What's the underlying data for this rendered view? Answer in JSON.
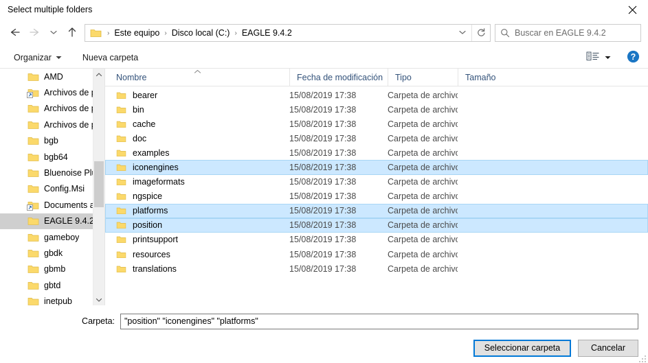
{
  "window": {
    "title": "Select multiple folders",
    "close_icon": "close-icon"
  },
  "nav": {
    "back_icon": "arrow-left-icon",
    "forward_icon": "arrow-right-icon",
    "recent_icon": "chevron-down-icon",
    "up_icon": "arrow-up-icon",
    "dropdown_icon": "chevron-down-icon",
    "refresh_icon": "refresh-icon",
    "folder_icon": "folder-icon",
    "breadcrumbs": [
      "Este equipo",
      "Disco local (C:)",
      "EAGLE 9.4.2"
    ],
    "separator": "›"
  },
  "search": {
    "placeholder": "Buscar en EAGLE 9.4.2",
    "icon": "search-icon",
    "value": ""
  },
  "toolbar": {
    "organize_label": "Organizar",
    "organize_caret_icon": "caret-down-icon",
    "new_folder_label": "Nueva carpeta",
    "view_icon": "view-layout-icon",
    "view_caret_icon": "caret-down-icon",
    "help_icon": "help-circle-icon",
    "help_label": "?"
  },
  "tree": {
    "scroll_up_icon": "chevron-up-icon",
    "scroll_down_icon": "chevron-down-icon",
    "items": [
      {
        "label": "AMD",
        "icon": "folder-icon",
        "shortcut": false,
        "selected": false
      },
      {
        "label": "Archivos de pr",
        "icon": "folder-icon",
        "shortcut": true,
        "selected": false
      },
      {
        "label": "Archivos de pr",
        "icon": "folder-icon",
        "shortcut": false,
        "selected": false
      },
      {
        "label": "Archivos de pr",
        "icon": "folder-icon",
        "shortcut": false,
        "selected": false
      },
      {
        "label": "bgb",
        "icon": "folder-icon",
        "shortcut": false,
        "selected": false
      },
      {
        "label": "bgb64",
        "icon": "folder-icon",
        "shortcut": false,
        "selected": false
      },
      {
        "label": "Bluenoise Plug",
        "icon": "folder-icon",
        "shortcut": false,
        "selected": false
      },
      {
        "label": "Config.Msi",
        "icon": "folder-icon",
        "shortcut": false,
        "selected": false
      },
      {
        "label": "Documents an",
        "icon": "folder-icon",
        "shortcut": true,
        "selected": false
      },
      {
        "label": "EAGLE 9.4.2",
        "icon": "folder-icon",
        "shortcut": false,
        "selected": true
      },
      {
        "label": "gameboy",
        "icon": "folder-icon",
        "shortcut": false,
        "selected": false
      },
      {
        "label": "gbdk",
        "icon": "folder-icon",
        "shortcut": false,
        "selected": false
      },
      {
        "label": "gbmb",
        "icon": "folder-icon",
        "shortcut": false,
        "selected": false
      },
      {
        "label": "gbtd",
        "icon": "folder-icon",
        "shortcut": false,
        "selected": false
      },
      {
        "label": "inetpub",
        "icon": "folder-icon",
        "shortcut": false,
        "selected": false
      }
    ]
  },
  "filelist": {
    "columns": [
      "Nombre",
      "Fecha de modificación",
      "Tipo",
      "Tamaño"
    ],
    "sort_column": "Nombre",
    "sort_direction": "ascending",
    "sort_icon": "chevron-up-icon",
    "rows": [
      {
        "name": "bearer",
        "date": "15/08/2019 17:38",
        "type": "Carpeta de archivos",
        "size": "",
        "selected": false,
        "icon": "folder-icon"
      },
      {
        "name": "bin",
        "date": "15/08/2019 17:38",
        "type": "Carpeta de archivos",
        "size": "",
        "selected": false,
        "icon": "folder-icon"
      },
      {
        "name": "cache",
        "date": "15/08/2019 17:38",
        "type": "Carpeta de archivos",
        "size": "",
        "selected": false,
        "icon": "folder-icon"
      },
      {
        "name": "doc",
        "date": "15/08/2019 17:38",
        "type": "Carpeta de archivos",
        "size": "",
        "selected": false,
        "icon": "folder-icon"
      },
      {
        "name": "examples",
        "date": "15/08/2019 17:38",
        "type": "Carpeta de archivos",
        "size": "",
        "selected": false,
        "icon": "folder-icon"
      },
      {
        "name": "iconengines",
        "date": "15/08/2019 17:38",
        "type": "Carpeta de archivos",
        "size": "",
        "selected": true,
        "icon": "folder-icon"
      },
      {
        "name": "imageformats",
        "date": "15/08/2019 17:38",
        "type": "Carpeta de archivos",
        "size": "",
        "selected": false,
        "icon": "folder-icon"
      },
      {
        "name": "ngspice",
        "date": "15/08/2019 17:38",
        "type": "Carpeta de archivos",
        "size": "",
        "selected": false,
        "icon": "folder-icon"
      },
      {
        "name": "platforms",
        "date": "15/08/2019 17:38",
        "type": "Carpeta de archivos",
        "size": "",
        "selected": true,
        "icon": "folder-icon"
      },
      {
        "name": "position",
        "date": "15/08/2019 17:38",
        "type": "Carpeta de archivos",
        "size": "",
        "selected": true,
        "icon": "folder-icon"
      },
      {
        "name": "printsupport",
        "date": "15/08/2019 17:38",
        "type": "Carpeta de archivos",
        "size": "",
        "selected": false,
        "icon": "folder-icon"
      },
      {
        "name": "resources",
        "date": "15/08/2019 17:38",
        "type": "Carpeta de archivos",
        "size": "",
        "selected": false,
        "icon": "folder-icon"
      },
      {
        "name": "translations",
        "date": "15/08/2019 17:38",
        "type": "Carpeta de archivos",
        "size": "",
        "selected": false,
        "icon": "folder-icon"
      }
    ]
  },
  "footer": {
    "folder_label": "Carpeta:",
    "folder_value": "\"position\" \"iconengines\" \"platforms\"",
    "select_button": "Seleccionar carpeta",
    "cancel_button": "Cancelar"
  },
  "colors": {
    "selection_fill": "#cce8ff",
    "selection_border": "#a8d6f5",
    "tree_selection": "#cfcfcf",
    "accent": "#0078d7",
    "column_header_text": "#33527a",
    "folder_yellow": "#fbd96b"
  }
}
